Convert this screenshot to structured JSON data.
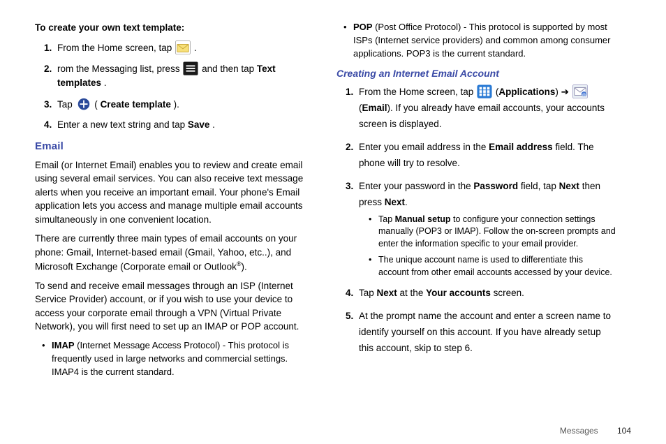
{
  "left": {
    "templateTitle": "To create your own text template:",
    "step1_a": "From the Home screen, tap ",
    "step1_b": ".",
    "step2_a": "rom the Messaging list, press ",
    "step2_b": " and then tap ",
    "step2_bold": "Text templates",
    "step2_c": ".",
    "step3_a": "Tap ",
    "step3_b": " (",
    "step3_bold": "Create template",
    "step3_c": ").",
    "step4_a": "Enter a new text string and tap ",
    "step4_bold": "Save",
    "step4_b": ".",
    "emailHeading": "Email",
    "emailPara1": "Email (or Internet Email) enables you to review and create email using several email services. You can also receive text message alerts when you receive an important email. Your phone's Email application lets you access and manage multiple email accounts simultaneously in one convenient location.",
    "emailPara2_a": "There are currently three main types of email accounts on your phone: Gmail, Internet-based email (Gmail, Yahoo, etc..), and Microsoft Exchange (Corporate email or Outlook",
    "emailPara2_sup": "®",
    "emailPara2_b": ").",
    "emailPara3": "To send and receive email messages through an ISP (Internet Service Provider) account, or if you wish to use your device to access your corporate email through a VPN (Virtual Private Network), you will first need to set up an IMAP or POP account.",
    "imapBold": "IMAP",
    "imapText": " (Internet Message Access Protocol) - This protocol is frequently used in large networks and commercial settings. IMAP4 is the current standard."
  },
  "right": {
    "popBold": "POP",
    "popText": " (Post Office Protocol) - This protocol is supported by most ISPs (Internet service providers) and common among consumer applications. POP3 is the current standard.",
    "createHeading": "Creating an Internet Email Account",
    "r1_a": "From the Home screen, tap ",
    "r1_b": " (",
    "r1_bold1": "Applications",
    "r1_c": ") ➔ ",
    "r1_d": " (",
    "r1_bold2": "Email",
    "r1_e": "). If you already have email accounts, your accounts screen is displayed.",
    "r2_a": "Enter you email address in the ",
    "r2_bold": "Email address",
    "r2_b": " field. The phone will try to resolve.",
    "r3_a": "Enter your password in the ",
    "r3_bold1": "Password",
    "r3_b": " field, tap ",
    "r3_bold2": "Next",
    "r3_c": " then press ",
    "r3_bold3": "Next",
    "r3_d": ".",
    "sub1_a": "Tap ",
    "sub1_bold": "Manual setup",
    "sub1_b": " to configure your connection settings manually (POP3 or IMAP). Follow the on-screen prompts and enter the information specific to your email provider.",
    "sub2": "The unique account name is used to differentiate this account from other email accounts accessed by your device.",
    "r4_a": "Tap ",
    "r4_bold1": "Next",
    "r4_b": " at the ",
    "r4_bold2": "Your accounts",
    "r4_c": " screen.",
    "r5": "At the prompt name the account and enter a screen name to identify yourself on this account. If you have already setup this account, skip to step 6."
  },
  "footer": {
    "section": "Messages",
    "page": "104"
  }
}
